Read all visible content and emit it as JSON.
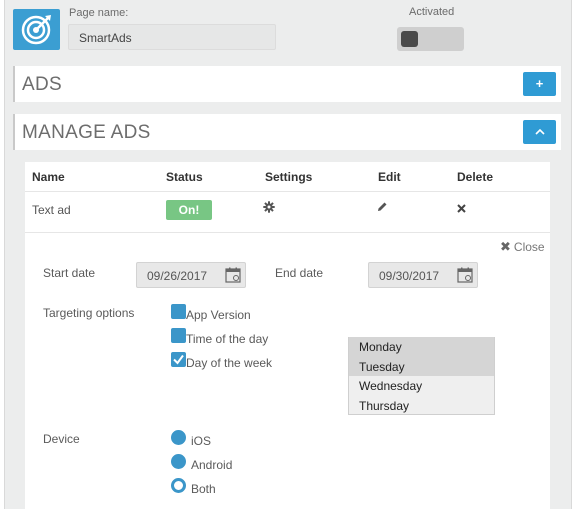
{
  "header": {
    "page_name_label": "Page name:",
    "page_name_value": "SmartAds",
    "activated_label": "Activated",
    "activated_on": false
  },
  "panels": {
    "ads_title": "ADS",
    "ads_button": "+",
    "manage_title": "MANAGE ADS",
    "manage_button": "^"
  },
  "table": {
    "columns": [
      "Name",
      "Status",
      "Settings",
      "Edit",
      "Delete"
    ],
    "rows": [
      {
        "name": "Text ad",
        "status": "On!",
        "settings_icon": "gear-icon",
        "edit_icon": "pencil-icon",
        "delete_icon": "close-icon"
      }
    ]
  },
  "detail": {
    "close_label": "Close",
    "start_date_label": "Start date",
    "start_date_value": "09/26/2017",
    "end_date_label": "End date",
    "end_date_value": "09/30/2017",
    "targeting_label": "Targeting options",
    "targeting_options": [
      {
        "label": "App Version",
        "checked": false
      },
      {
        "label": "Time of the day",
        "checked": false
      },
      {
        "label": "Day of the week",
        "checked": true
      }
    ],
    "days": [
      {
        "label": "Monday",
        "selected": true
      },
      {
        "label": "Tuesday",
        "selected": true
      },
      {
        "label": "Wednesday",
        "selected": false
      },
      {
        "label": "Thursday",
        "selected": false
      }
    ],
    "device_label": "Device",
    "devices": [
      {
        "label": "iOS",
        "selected": true
      },
      {
        "label": "Android",
        "selected": true
      },
      {
        "label": "Both",
        "selected": false
      }
    ]
  },
  "colors": {
    "accent": "#2f9bd4",
    "status_on": "#78c684",
    "checkbox": "#3b96c9"
  }
}
